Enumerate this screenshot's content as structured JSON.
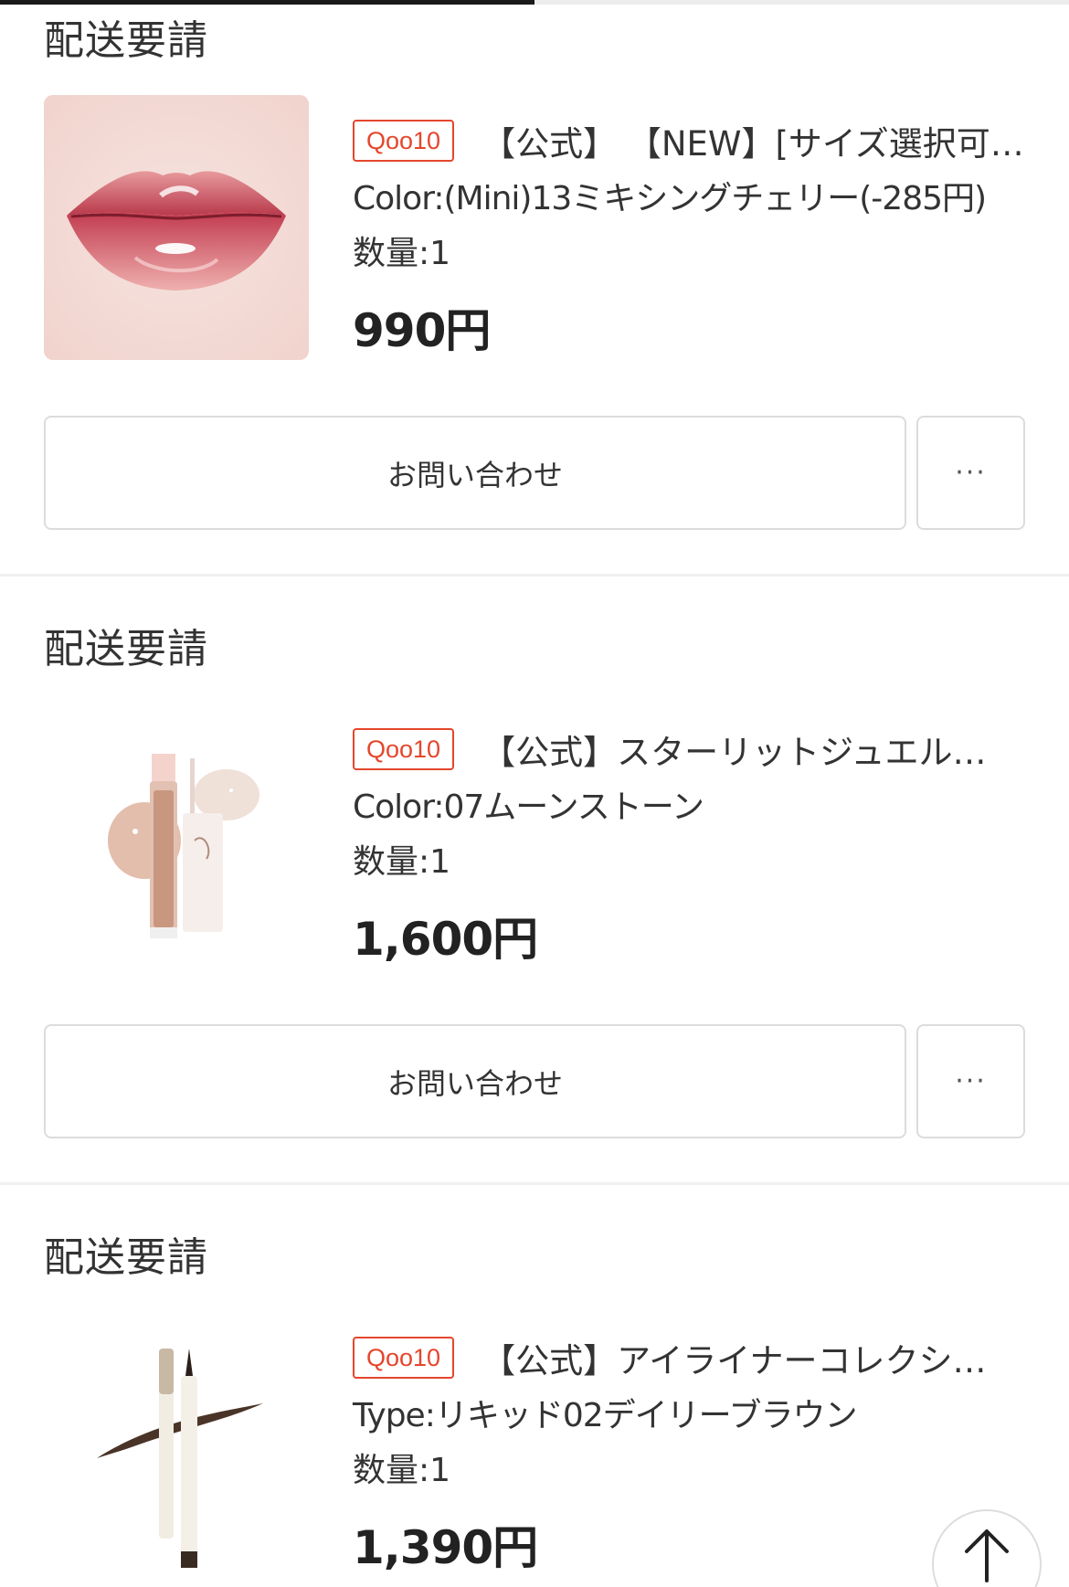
{
  "progress": {
    "fraction": 0.5
  },
  "orders": [
    {
      "status": "配送要請",
      "badge": "Qoo10",
      "title": "【公式】 【NEW】[サイズ選択可…",
      "option": "Color:(Mini)13ミキシングチェリー(-285円)",
      "qty": "数量:1",
      "price": "990円",
      "contact_label": "お問い合わせ",
      "more_label": "···",
      "image": "lip-gloss-lips-photo"
    },
    {
      "status": "配送要請",
      "badge": "Qoo10",
      "title": "【公式】スターリットジュエル…",
      "option": "Color:07ムーンストーン",
      "qty": "数量:1",
      "price": "1,600円",
      "contact_label": "お問い合わせ",
      "more_label": "···",
      "image": "glitter-liquid-eyeshadow-product"
    },
    {
      "status": "配送要請",
      "badge": "Qoo10",
      "title": "【公式】アイライナーコレクシ…",
      "option": "Type:リキッド02デイリーブラウン",
      "qty": "数量:1",
      "price": "1,390円",
      "image": "liquid-eyeliner-product"
    }
  ],
  "scroll_top": {
    "icon": "arrow-up-icon"
  }
}
